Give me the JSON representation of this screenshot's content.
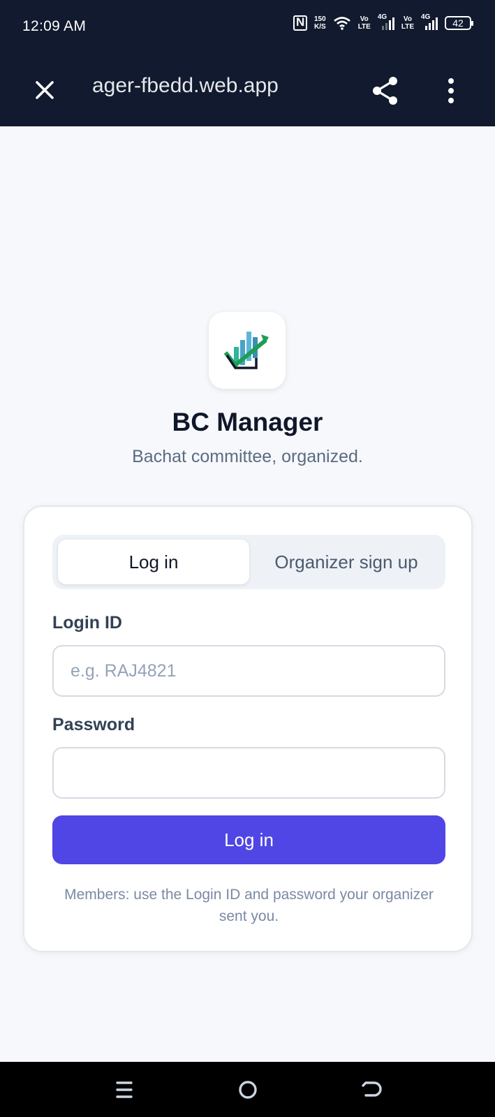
{
  "status_bar": {
    "time": "12:09 AM",
    "speed_value": "150",
    "speed_unit": "K/S",
    "sim1_volte": "Vo",
    "sim1_lte": "LTE",
    "sim1_net": "4G",
    "sim2_volte": "Vo",
    "sim2_lte": "LTE",
    "sim2_net": "4G",
    "battery": "42"
  },
  "browser": {
    "url": "ager-fbedd.web.app",
    "close_icon": "close-icon",
    "share_icon": "share-icon",
    "menu_icon": "more-vertical-icon"
  },
  "app": {
    "title": "BC Manager",
    "subtitle": "Bachat committee, organized.",
    "logo_icon": "chart-growth-logo"
  },
  "auth": {
    "tabs": [
      {
        "label": "Log in",
        "active": true
      },
      {
        "label": "Organizer sign up",
        "active": false
      }
    ],
    "login_id_label": "Login ID",
    "login_id_placeholder": "e.g. RAJ4821",
    "login_id_value": "",
    "password_label": "Password",
    "password_value": "",
    "submit_label": "Log in",
    "note": "Members: use the Login ID and password your organizer sent you."
  },
  "colors": {
    "header_bg": "#111a2e",
    "accent": "#4f46e5",
    "page_bg": "#f6f8fb"
  },
  "nav": {
    "menu_icon": "recent-apps-icon",
    "home_icon": "home-icon",
    "back_icon": "back-icon"
  }
}
